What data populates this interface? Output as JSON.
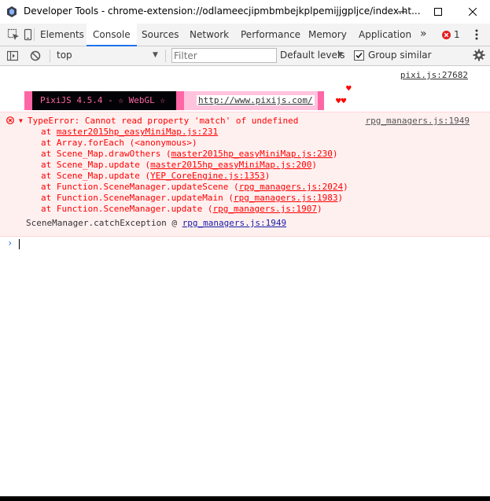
{
  "window": {
    "title": "Developer Tools - chrome-extension://odlameecjipmbmbejkplpemijjgpljce/index.ht...",
    "app_icon": "devtools-icon"
  },
  "tabs": [
    "Elements",
    "Console",
    "Sources",
    "Network",
    "Performance",
    "Memory",
    "Application"
  ],
  "active_tab": "Console",
  "tabbar": {
    "more": "»",
    "error_count": "1"
  },
  "toolbar": {
    "context": "top",
    "filter_placeholder": "Filter",
    "levels": "Default levels",
    "group_similar": "Group similar",
    "group_similar_checked": true
  },
  "console": {
    "pixi_source": "pixi.js:27682",
    "banner_text": "PixiJS 4.5.4 - ☆ WebGL ☆",
    "banner_url": "http://www.pixijs.com/",
    "hearts_top": "♥",
    "hearts_bottom": "♥♥",
    "error": {
      "message": "TypeError: Cannot read property 'match' of undefined",
      "source": "rpg_managers.js:1949",
      "stack": [
        {
          "prefix": "at ",
          "file": "master2015hp_easyMiniMap.js:231",
          "paren": false,
          "fn": ""
        },
        {
          "prefix": "at Array.forEach (<anonymous>)",
          "file": "",
          "paren": false,
          "fn": ""
        },
        {
          "prefix": "at Scene_Map.drawOthers (",
          "file": "master2015hp_easyMiniMap.js:230",
          "paren": true,
          "fn": ""
        },
        {
          "prefix": "at Scene_Map.update (",
          "file": "master2015hp_easyMiniMap.js:200",
          "paren": true,
          "fn": ""
        },
        {
          "prefix": "at Scene_Map.update (",
          "file": "YEP_CoreEngine.js:1353",
          "paren": true,
          "fn": ""
        },
        {
          "prefix": "at Function.SceneManager.updateScene (",
          "file": "rpg_managers.js:2024",
          "paren": true,
          "fn": ""
        },
        {
          "prefix": "at Function.SceneManager.updateMain (",
          "file": "rpg_managers.js:1983",
          "paren": true,
          "fn": ""
        },
        {
          "prefix": "at Function.SceneManager.update (",
          "file": "rpg_managers.js:1907",
          "paren": true,
          "fn": ""
        }
      ],
      "catch_prefix": "SceneManager.catchException @ ",
      "catch_file": "rpg_managers.js:1949"
    },
    "prompt_symbol": "›"
  },
  "colors": {
    "error_red": "#ff0000",
    "error_bg": "#fff0f0",
    "pixi_pink": "#ff66a5",
    "pixi_light_pink": "#ffc3dd",
    "active_tab_accent": "#1a73e8"
  }
}
